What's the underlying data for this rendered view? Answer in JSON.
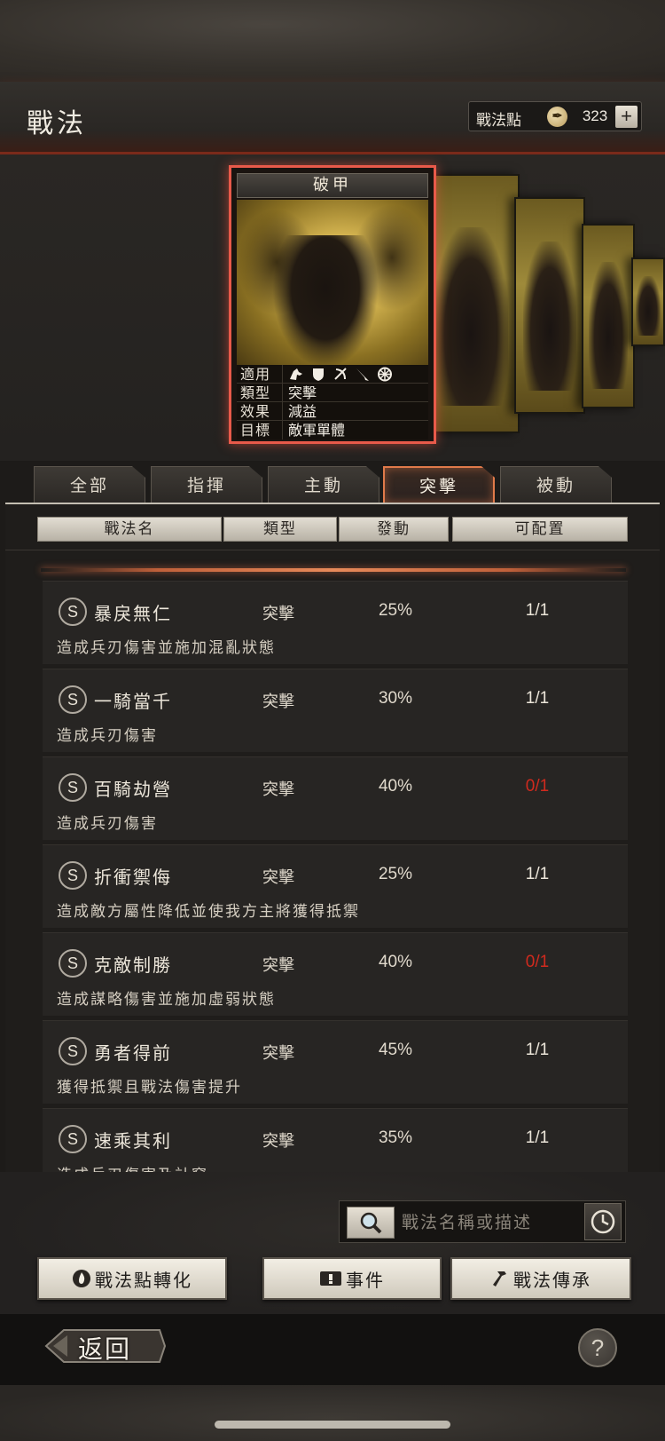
{
  "header": {
    "title": "戰法",
    "points_label": "戰法點",
    "points_value": "323",
    "plus_label": "+"
  },
  "card": {
    "name": "破甲",
    "rows": [
      {
        "key": "適用",
        "value": ""
      },
      {
        "key": "類型",
        "value": "突擊"
      },
      {
        "key": "效果",
        "value": "減益"
      },
      {
        "key": "目標",
        "value": "敵軍單體"
      }
    ],
    "unit_icons": [
      "cavalry-icon",
      "shield-icon",
      "bow-icon",
      "spear-icon",
      "wheel-icon"
    ]
  },
  "tabs": [
    {
      "label": "全部",
      "active": false
    },
    {
      "label": "指揮",
      "active": false
    },
    {
      "label": "主動",
      "active": false
    },
    {
      "label": "突擊",
      "active": true
    },
    {
      "label": "被動",
      "active": false
    }
  ],
  "columns": [
    "戰法名",
    "類型",
    "發動",
    "可配置"
  ],
  "rows": [
    {
      "badge": "S",
      "name": "暴戾無仁",
      "type": "突擊",
      "rate": "25%",
      "slots": "1/1",
      "full": false,
      "desc": "造成兵刃傷害並施加混亂狀態"
    },
    {
      "badge": "S",
      "name": "一騎當千",
      "type": "突擊",
      "rate": "30%",
      "slots": "1/1",
      "full": false,
      "desc": "造成兵刃傷害"
    },
    {
      "badge": "S",
      "name": "百騎劫營",
      "type": "突擊",
      "rate": "40%",
      "slots": "0/1",
      "full": true,
      "desc": "造成兵刃傷害"
    },
    {
      "badge": "S",
      "name": "折衝禦侮",
      "type": "突擊",
      "rate": "25%",
      "slots": "1/1",
      "full": false,
      "desc": "造成敵方屬性降低並使我方主將獲得抵禦"
    },
    {
      "badge": "S",
      "name": "克敵制勝",
      "type": "突擊",
      "rate": "40%",
      "slots": "0/1",
      "full": true,
      "desc": "造成謀略傷害並施加虛弱狀態"
    },
    {
      "badge": "S",
      "name": "勇者得前",
      "type": "突擊",
      "rate": "45%",
      "slots": "1/1",
      "full": false,
      "desc": "獲得抵禦且戰法傷害提升"
    },
    {
      "badge": "S",
      "name": "速乘其利",
      "type": "突擊",
      "rate": "35%",
      "slots": "1/1",
      "full": false,
      "desc": "造成兵刃傷害及計窮"
    }
  ],
  "search": {
    "placeholder": "戰法名稱或描述"
  },
  "buttons": {
    "convert": "戰法點轉化",
    "event": "事件",
    "inherit": "戰法傳承"
  },
  "footer": {
    "back": "返回",
    "help": "?"
  },
  "colors": {
    "accent": "#e85a4a",
    "full_slots": "#d02a1e",
    "active_tab_border": "#e07a4a"
  }
}
